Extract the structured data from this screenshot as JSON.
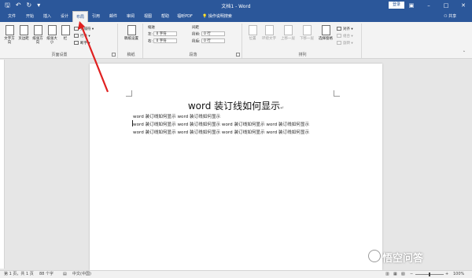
{
  "titlebar": {
    "doc_title": "文档1 - Word",
    "login": "登录",
    "qat_icons": [
      "save-icon",
      "undo-icon",
      "redo-icon",
      "customize-icon"
    ]
  },
  "tabs": [
    "文件",
    "开始",
    "插入",
    "设计",
    "布局",
    "引用",
    "邮件",
    "审阅",
    "视图",
    "帮助",
    "福昕PDF"
  ],
  "active_tab": "布局",
  "tell_me": "操作说明搜索",
  "share": "共享",
  "ribbon": {
    "page_setup": {
      "text_direction": "文字方向",
      "margins": "页边距",
      "orientation": "纸张方向",
      "size": "纸张大小",
      "columns": "栏",
      "breaks": "分隔符",
      "line_numbers": "行号",
      "hyphenation": "断字",
      "label": "页面设置"
    },
    "manuscript": {
      "button": "稿纸设置",
      "label": "稿纸"
    },
    "paragraph": {
      "indent": "缩进",
      "spacing": "间距",
      "left": "左:",
      "right": "右:",
      "before": "段前:",
      "after": "段后:",
      "left_value": "0 字符",
      "right_value": "0 字符",
      "before_value": "0 行",
      "after_value": "0 行",
      "label": "段落"
    },
    "arrange": {
      "position": "位置",
      "wrap_text": "环绕文字",
      "bring_forward": "上移一层",
      "send_backward": "下移一层",
      "selection_pane": "选择窗格",
      "align": "对齐",
      "group": "组合",
      "rotate": "旋转",
      "label": "排列"
    }
  },
  "document": {
    "heading": "word 装订线如何显示",
    "lines": [
      "word 装订线如何显示 word 装订线如何显示",
      "word 装订线如何显示 word 装订线如何显示 word 装订线如何显示 word 装订线如何显示",
      "word 装订线如何显示 word 装订线如何显示 word 装订线如何显示 word 装订线如何显示"
    ]
  },
  "statusbar": {
    "page": "第 1 页，共 1 页",
    "words": "88 个字",
    "language": "中文(中国)",
    "zoom": "100%"
  },
  "watermark": "悟空问答",
  "colors": {
    "accent": "#2b579a",
    "arrow": "#e02020"
  }
}
